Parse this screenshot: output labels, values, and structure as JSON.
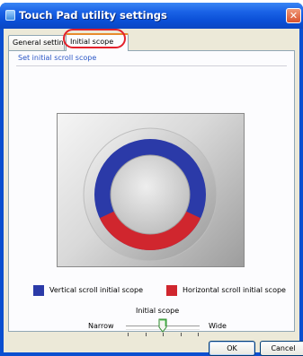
{
  "window": {
    "title": "Touch Pad utility settings",
    "close_glyph": "✕"
  },
  "tabs": [
    {
      "label": "General settings",
      "selected": false
    },
    {
      "label": "Initial scope",
      "selected": true
    }
  ],
  "group": {
    "label": "Set initial scroll scope"
  },
  "scope_ring": {
    "vertical_color": "#2b3aa8",
    "horizontal_color": "#d0262e"
  },
  "legend": [
    {
      "label": "Vertical scroll initial scope",
      "color": "#2b3aa8"
    },
    {
      "label": "Horizontal scroll initial scope",
      "color": "#d0262e"
    }
  ],
  "slider": {
    "caption": "Initial scope",
    "min_label": "Narrow",
    "max_label": "Wide",
    "ticks": 5,
    "position_index": 2
  },
  "buttons": {
    "ok": "OK",
    "cancel": "Cancel"
  },
  "colors": {
    "title_bar": "#0b4fd0",
    "highlight_circle": "#e3202a",
    "group_label": "#2a56c6"
  }
}
